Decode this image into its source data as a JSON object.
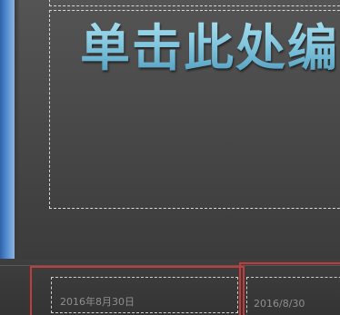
{
  "slide": {
    "title_placeholder_text": "单击此处编",
    "date_left": "2016年8月30日",
    "date_right": "2016/8/30"
  },
  "colors": {
    "left_edge_blue": "#4a82c9",
    "title_cyan": "#8fd0e6",
    "highlight_red": "#c43b3b",
    "placeholder_border": "#d9d9d9",
    "date_text_gray": "#8f8f8f"
  }
}
